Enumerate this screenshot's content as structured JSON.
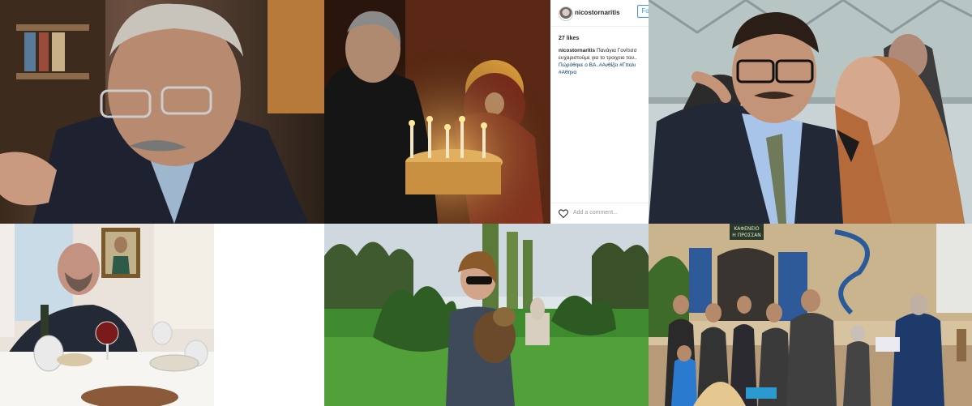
{
  "instagram": {
    "username": "nicostornaritis",
    "follow_label": "Fo",
    "likes": "27 likes",
    "caption_lines": [
      {
        "text": "nicostornaritis",
        "style": "user",
        "tail": " Πανάγια Γονίτισσ"
      },
      {
        "text": "ευχαριστούμε για το τροιχειο του..",
        "style": "plain"
      },
      {
        "text": "Πώρόθηκε ο ΒΑ..#Ανθίζει #Γπολι",
        "style": "tag"
      },
      {
        "text": "#Αθηνα",
        "style": "tag"
      }
    ],
    "comment_placeholder": "Add a comment..."
  },
  "tavern_sign": "ΚΑΦΕΝΕΙΟ\nΗ ΠΡΟΣΣΑΝ"
}
